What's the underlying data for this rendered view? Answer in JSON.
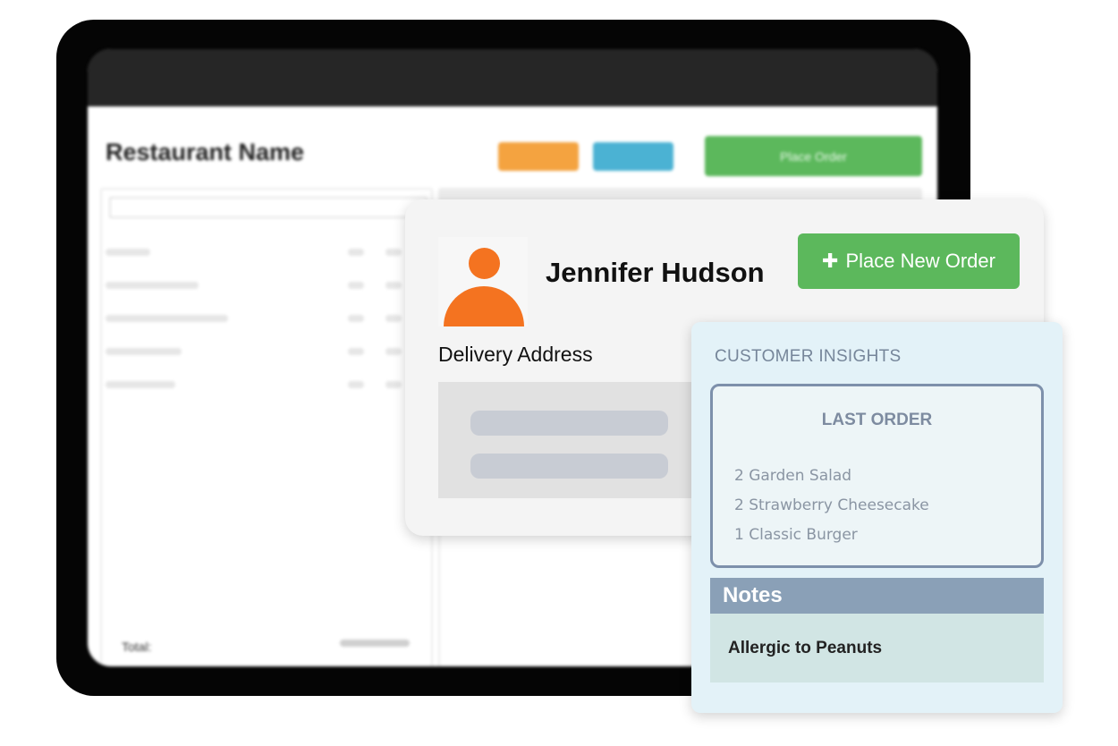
{
  "app": {
    "restaurant_name": "Restaurant Name",
    "place_order_label": "Place Order",
    "total_label": "Total:"
  },
  "customer": {
    "name": "Jennifer Hudson",
    "place_new_order_label": "Place New Order",
    "delivery_address_label": "Delivery Address"
  },
  "insights": {
    "title": "CUSTOMER INSIGHTS",
    "last_order_title": "LAST ORDER",
    "last_order_items": [
      "2 Garden Salad",
      "2 Strawberry Cheesecake",
      "1 Classic Burger"
    ],
    "notes_title": "Notes",
    "notes_text": "Allergic to Peanuts"
  },
  "colors": {
    "accent_green": "#5cb85c",
    "avatar_orange": "#f47320",
    "insights_bg": "#e3f2f8",
    "notes_header": "#8aa0b7"
  },
  "icons": {
    "plus": "plus-icon",
    "avatar": "person-icon"
  }
}
